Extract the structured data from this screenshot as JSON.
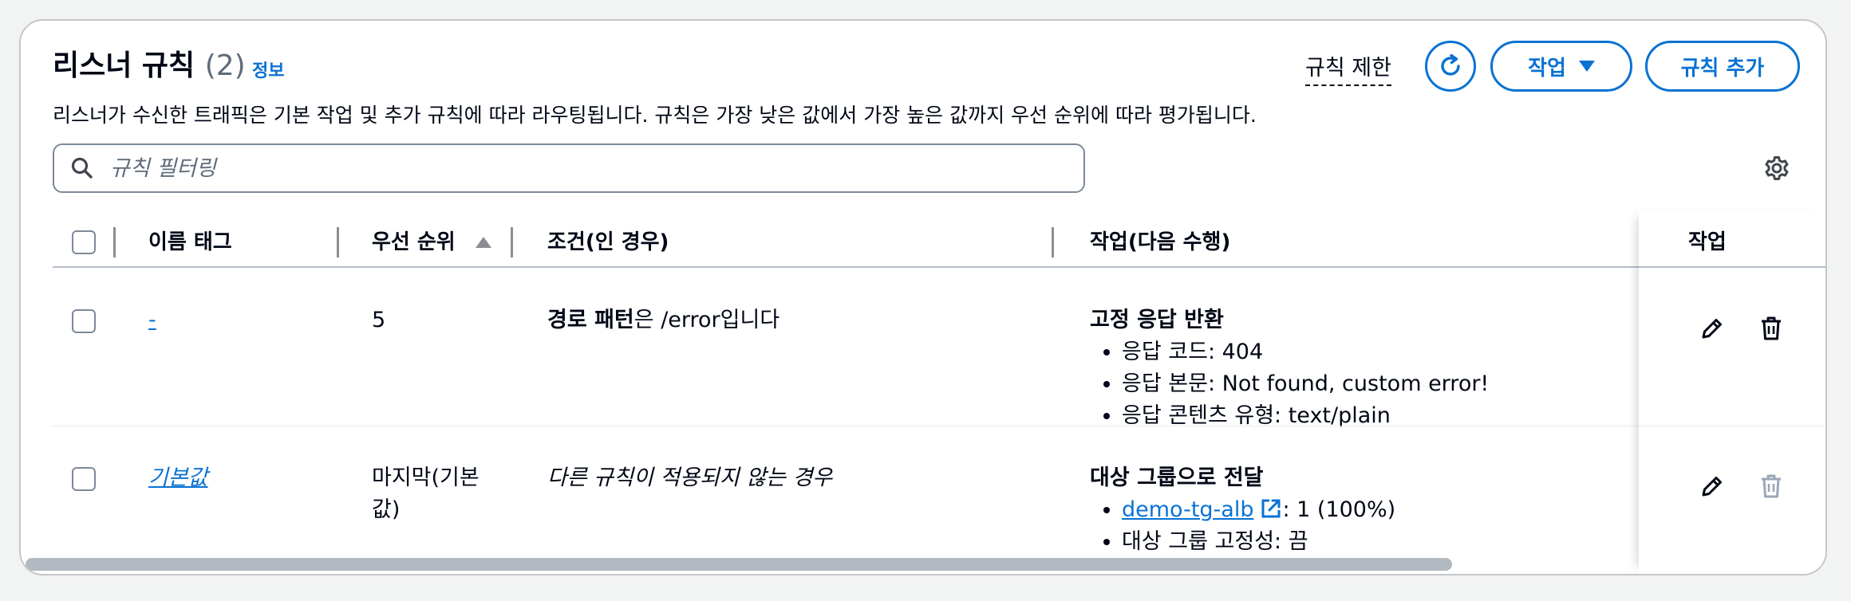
{
  "header": {
    "title": "리스너 규칙",
    "count": "(2)",
    "info_link": "정보",
    "description": "리스너가 수신한 트래픽은 기본 작업 및 추가 규칙에 따라 라우팅됩니다. 규칙은 가장 낮은 값에서 가장 높은 값까지 우선 순위에 따라 평가됩니다.",
    "limits_link": "규칙 제한",
    "actions_button": "작업",
    "add_rule_button": "규칙 추가"
  },
  "search": {
    "placeholder": "규칙 필터링",
    "value": ""
  },
  "table": {
    "columns": {
      "name_tag": "이름 태그",
      "priority": "우선 순위",
      "conditions": "조건(인 경우)",
      "actions": "작업(다음 수행)",
      "row_actions": "작업"
    },
    "sort_column": "priority",
    "sort_direction": "ascending",
    "rows": [
      {
        "name": "-",
        "priority": "5",
        "condition_bold": "경로 패턴",
        "condition_rest": "은 /error입니다",
        "action_title": "고정 응답 반환",
        "action_items": [
          "응답 코드: 404",
          "응답 본문: Not found, custom error!",
          "응답 콘텐츠 유형: text/plain"
        ],
        "delete_enabled": true
      },
      {
        "name": "기본값",
        "priority_line1": "마지막(기본",
        "priority_line2": "값)",
        "condition": "다른 규칙이 적용되지 않는 경우",
        "action_title": "대상 그룹으로 전달",
        "target_group_link": "demo-tg-alb",
        "target_group_weight": ": 1 (100%)",
        "stickiness": "대상 그룹 고정성: 끔",
        "delete_enabled": false
      }
    ]
  },
  "colors": {
    "accent": "#0972d3",
    "text": "#000716",
    "muted": "#5f6b7a",
    "border": "#c6c6cd",
    "disabled_icon": "#9ba7b6"
  },
  "icons": [
    "refresh-icon",
    "caret-down-icon",
    "search-icon",
    "settings-gear-icon",
    "sort-ascending-icon",
    "edit-pencil-icon",
    "delete-trash-icon",
    "external-link-icon"
  ],
  "horizontal_scroll": {
    "position": 0.0,
    "visible_fraction": 0.79
  }
}
